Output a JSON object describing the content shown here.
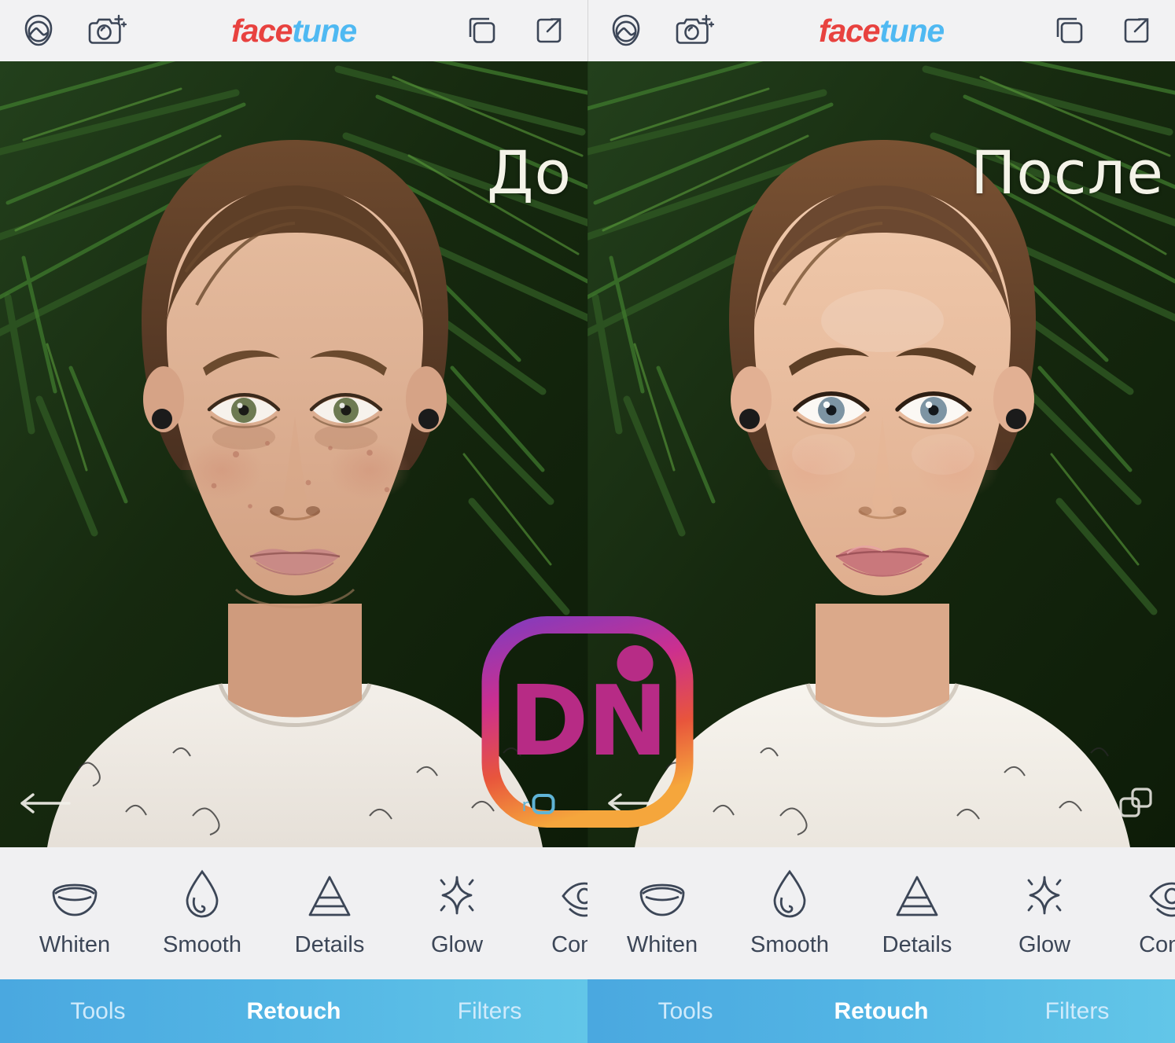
{
  "app": {
    "brand_first": "face",
    "brand_second": "tune",
    "brand_color_red": "#e8423f",
    "brand_color_blue": "#4fb9f2",
    "header_bg": "#f2f2f3",
    "toolbar_bg": "#f0f0f2",
    "nav_gradient_start": "#4aa8e0",
    "nav_gradient_end": "#62c6e8"
  },
  "header": {
    "icons_left": [
      {
        "name": "portrait-gallery-icon",
        "label": "Portrait"
      },
      {
        "name": "camera-sparkle-icon",
        "label": "Camera"
      }
    ],
    "icons_right": [
      {
        "name": "layers-compare-icon",
        "label": "Compare"
      },
      {
        "name": "share-export-icon",
        "label": "Export"
      }
    ]
  },
  "panels": [
    {
      "caption": "До",
      "caption_wide": false
    },
    {
      "caption": "После",
      "caption_wide": true
    }
  ],
  "photo": {
    "undo_icon": "undo-arrow-icon",
    "compare_icon": "compare-layers-icon",
    "subject": "portrait of a woman in front of green palm fronds"
  },
  "toolbar": {
    "tools": [
      {
        "label": "Whiten",
        "icon": "teeth-smile-icon"
      },
      {
        "label": "Smooth",
        "icon": "water-drop-icon"
      },
      {
        "label": "Details",
        "icon": "triangle-layers-icon"
      },
      {
        "label": "Glow",
        "icon": "sparkle-star-icon"
      },
      {
        "label": "Conce",
        "icon": "eye-concealer-icon"
      }
    ]
  },
  "bottom_nav": {
    "items": [
      {
        "label": "Tools",
        "active": false
      },
      {
        "label": "Retouch",
        "active": true
      },
      {
        "label": "Filters",
        "active": false
      }
    ]
  },
  "watermark": {
    "text": "DN",
    "sub_letter": "r",
    "sub_icon": "rounded-square-icon",
    "ring_gradient": [
      "#8a3ab9",
      "#cc2f8f",
      "#e8553c",
      "#f5a63c"
    ],
    "text_color": "#c42c8f"
  }
}
